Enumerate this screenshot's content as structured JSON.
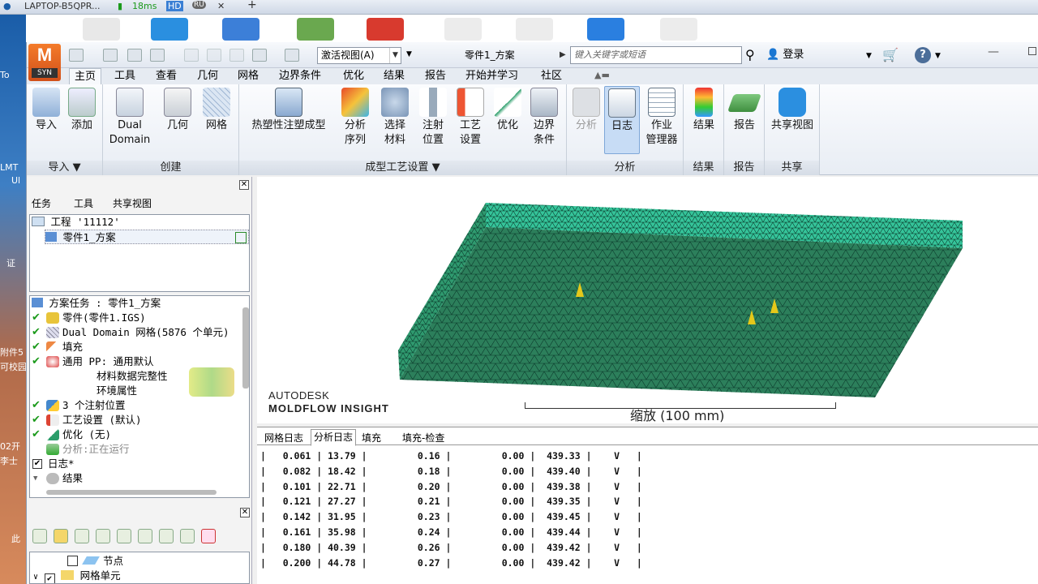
{
  "taskbar": {
    "machine": "LAPTOP-B5QPR...",
    "ping": "18ms",
    "hd_badge": "HD",
    "ru_badge": "RU",
    "close_glyph": "✕",
    "plus_glyph": "+"
  },
  "desktop_labels": [
    "To",
    "LMT",
    "Ul",
    "证",
    "附件5",
    "可校园",
    "02开",
    "李士",
    "此"
  ],
  "app": {
    "logo_letter": "M",
    "logo_sub": "SYN",
    "view_combo": "激活视图(A)",
    "doc_title": "零件1_方案",
    "search_placeholder": "键入关键字或短语",
    "login": "登录",
    "help": "?"
  },
  "tabs": [
    "主页",
    "工具",
    "查看",
    "几何",
    "网格",
    "边界条件",
    "优化",
    "结果",
    "报告",
    "开始并学习",
    "社区"
  ],
  "ribbon": {
    "groups": {
      "import": "导入",
      "create": "创建",
      "process": "成型工艺设置",
      "analysis": "分析",
      "results": "结果",
      "report": "报告",
      "share": "共享"
    },
    "buttons": {
      "import": "导入",
      "add": "添加",
      "dual1": "Dual",
      "dual2": "Domain",
      "geometry": "几何",
      "mesh": "网格",
      "thermo": "热塑性注塑成型",
      "seq1": "分析",
      "seq2": "序列",
      "mat1": "选择",
      "mat2": "材料",
      "inj1": "注射",
      "inj2": "位置",
      "proc1": "工艺",
      "proc2": "设置",
      "optimize": "优化",
      "bc1": "边界",
      "bc2": "条件",
      "analyze": "分析",
      "log": "日志",
      "job1": "作业",
      "job2": "管理器",
      "results": "结果",
      "report": "报告",
      "shareview": "共享视图"
    }
  },
  "left_panel": {
    "tabs": [
      "任务",
      "工具",
      "共享视图"
    ],
    "project": "工程 '11112'",
    "study": "零件1_方案",
    "tasks_header": "方案任务 : 零件1_方案",
    "tasks": [
      "零件(零件1.IGS)",
      "Dual Domain 网格(5876 个单元)",
      "填充",
      "通用 PP: 通用默认",
      "材料数据完整性",
      "环境属性",
      "3 个注射位置",
      "工艺设置 (默认)",
      "优化 (无)",
      "分析:正在运行",
      "日志*",
      "结果"
    ],
    "layers": [
      "节点",
      "网格单元"
    ]
  },
  "viewport": {
    "brand_top": "AUTODESK",
    "brand_bottom": "MOLDFLOW INSIGHT",
    "scale_label": "缩放 (100 mm)",
    "mesh_color": "#35c49a"
  },
  "log": {
    "tabs": [
      "网格日志",
      "分析日志",
      "填充",
      "填充-检查"
    ],
    "rows": [
      [
        "0.061",
        "13.79",
        "0.16",
        "0.00",
        "439.33",
        "V"
      ],
      [
        "0.082",
        "18.42",
        "0.18",
        "0.00",
        "439.40",
        "V"
      ],
      [
        "0.101",
        "22.71",
        "0.20",
        "0.00",
        "439.38",
        "V"
      ],
      [
        "0.121",
        "27.27",
        "0.21",
        "0.00",
        "439.35",
        "V"
      ],
      [
        "0.142",
        "31.95",
        "0.23",
        "0.00",
        "439.45",
        "V"
      ],
      [
        "0.161",
        "35.98",
        "0.24",
        "0.00",
        "439.44",
        "V"
      ],
      [
        "0.180",
        "40.39",
        "0.26",
        "0.00",
        "439.42",
        "V"
      ],
      [
        "0.200",
        "44.78",
        "0.27",
        "0.00",
        "439.42",
        "V"
      ]
    ]
  }
}
